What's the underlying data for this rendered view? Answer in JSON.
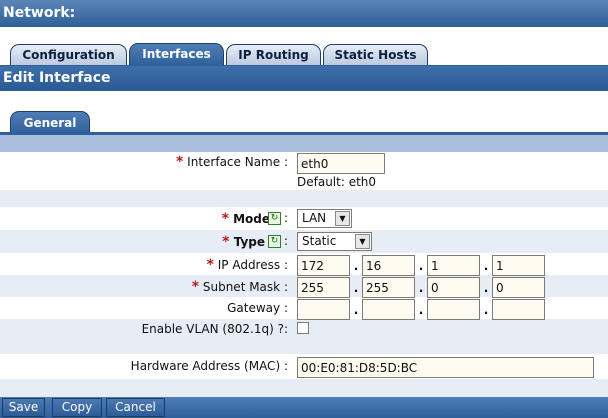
{
  "page": {
    "title": "Network:"
  },
  "tabs": [
    {
      "label": "Configuration"
    },
    {
      "label": "Interfaces"
    },
    {
      "label": "IP Routing"
    },
    {
      "label": "Static Hosts"
    }
  ],
  "section": {
    "title": "Edit Interface",
    "subtab": "General"
  },
  "form": {
    "interface_name": {
      "label": "Interface Name",
      "value": "eth0",
      "default_text": "Default: eth0"
    },
    "mode": {
      "label": "Mode",
      "value": "LAN"
    },
    "type": {
      "label": "Type",
      "value": "Static"
    },
    "ip_address": {
      "label": "IP Address",
      "octets": [
        "172",
        "16",
        "1",
        "1"
      ]
    },
    "subnet_mask": {
      "label": "Subnet Mask",
      "octets": [
        "255",
        "255",
        "0",
        "0"
      ]
    },
    "gateway": {
      "label": "Gateway",
      "octets": [
        "",
        "",
        "",
        ""
      ]
    },
    "vlan": {
      "label": "Enable VLAN (802.1q) ?",
      "checked": false
    },
    "mac": {
      "label": "Hardware Address (MAC)",
      "value": "00:E0:81:D8:5D:BC"
    },
    "colon": ":",
    "required_mark": "*",
    "dot": "."
  },
  "buttons": {
    "save": "Save",
    "copy": "Copy",
    "cancel": "Cancel"
  }
}
